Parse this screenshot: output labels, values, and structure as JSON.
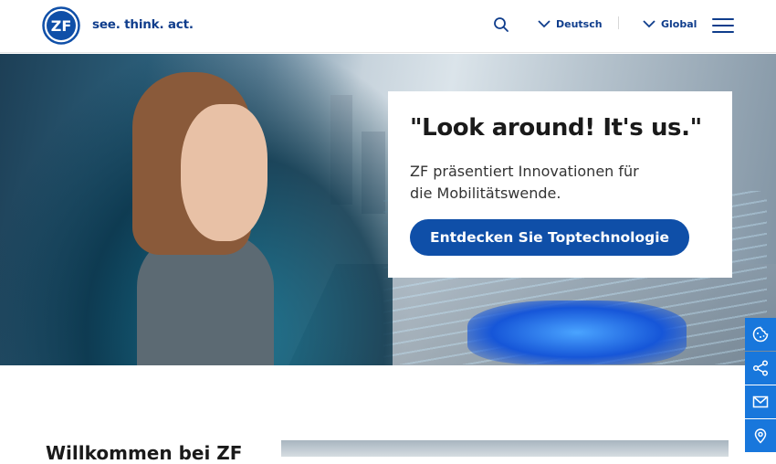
{
  "header": {
    "logo_text": "ZF",
    "tagline": "see. think. act.",
    "language_label": "Deutsch",
    "region_label": "Global",
    "icons": [
      "zf-logo",
      "search-icon",
      "chevron-down-icon",
      "menu-icon"
    ]
  },
  "hero": {
    "title": "\"Look around! It's us.\"",
    "text": "ZF präsentiert Innovationen für die Mobilitätswende.",
    "cta_label": "Entdecken Sie Toptechnologie"
  },
  "side_tools": {
    "icons": [
      "cookie-icon",
      "share-icon",
      "mail-icon",
      "location-icon"
    ],
    "color": "#1877dc"
  },
  "content": {
    "welcome_heading": "Willkommen bei ZF"
  },
  "colors": {
    "brand": "#0f3d8c",
    "cta": "#0f4fa8"
  }
}
